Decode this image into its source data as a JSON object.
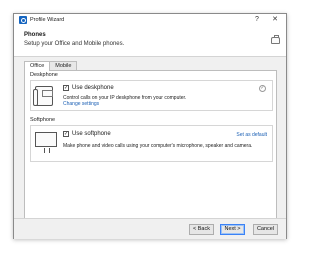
{
  "window": {
    "title": "Profile Wizard",
    "help_glyph": "?",
    "close_glyph": "✕"
  },
  "header": {
    "title": "Phones",
    "subtitle": "Setup your Office and Mobile phones."
  },
  "tabs": [
    {
      "label": "Office",
      "active": true
    },
    {
      "label": "Mobile",
      "active": false
    }
  ],
  "deskphone": {
    "group_label": "Deskphone",
    "checkbox_label": "Use deskphone",
    "checked": true,
    "description": "Control calls on your IP deskphone from your computer.",
    "link": "Change settings"
  },
  "softphone": {
    "group_label": "Softphone",
    "checkbox_label": "Use softphone",
    "checked": true,
    "set_default": "Set as default",
    "description": "Make phone and video calls using your computer's microphone, speaker and camera."
  },
  "footer": {
    "back": "< Back",
    "next": "Next >",
    "cancel": "Cancel"
  },
  "icons": {
    "app": "profile-wizard-icon",
    "header": "phone-handset-icon",
    "deskphone": "desk-phone-icon",
    "softphone": "computer-icon",
    "status": "check-circle-icon"
  },
  "colors": {
    "accent": "#1565c0",
    "link": "#1a5fb4",
    "primary_button_border": "#3b82f6"
  }
}
